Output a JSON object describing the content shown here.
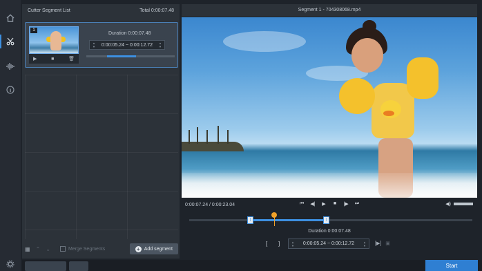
{
  "rail": {
    "icons": [
      "home-icon",
      "cut-icon",
      "audio-icon",
      "info-icon",
      "settings-icon"
    ]
  },
  "segment_list": {
    "title": "Cutter Segment List",
    "total": "Total 0:00:07.48",
    "item": {
      "number": "1",
      "duration": "Duration 0:00:07.48",
      "range": "0:00:05.24 ~ 0:00:12.72",
      "controls": [
        "play-icon",
        "stop-icon",
        "delete-icon"
      ]
    },
    "footer": {
      "merge_label": "Merge Segments",
      "add_label": "Add segment"
    }
  },
  "preview": {
    "title": "Segment 1 - 704308068.mp4",
    "time_readout": "0:00:07.24 / 0:00:23.04",
    "playback_icons": [
      "skip-back-icon",
      "frame-back-icon",
      "play-icon",
      "stop-icon",
      "frame-forward-icon",
      "skip-forward-icon"
    ],
    "duration": "Duration 0:00:07.48",
    "range": "0:00:05.24 ~ 0:00:12.72",
    "timeline": {
      "start_marker": "[",
      "end_marker": "]",
      "playhead_fraction": 0.31,
      "selection_start_fraction": 0.22,
      "selection_end_fraction": 0.49
    },
    "volume_fraction": 0.7
  },
  "footer": {
    "start_label": "Start"
  },
  "colors": {
    "accent": "#3d8fe0",
    "playhead": "#f0a028",
    "start_button": "#2f7fd2"
  }
}
